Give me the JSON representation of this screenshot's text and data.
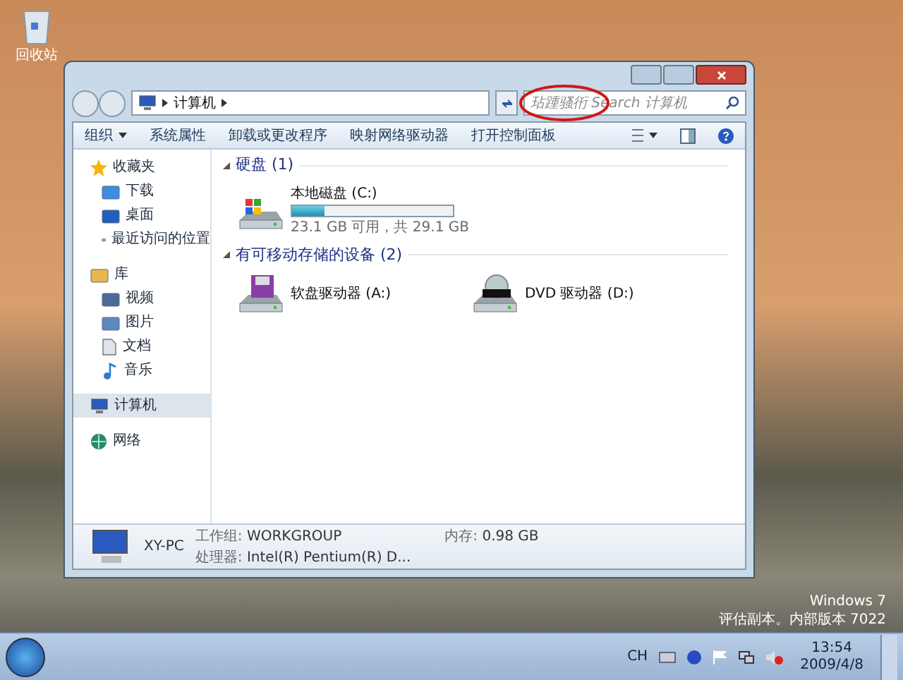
{
  "desktop": {
    "icons": [
      {
        "label": "回收站"
      }
    ],
    "watermark_lines": [
      "Windows 7",
      "评估副本。内部版本 7022"
    ]
  },
  "window": {
    "address": {
      "crumbs": [
        "计算机"
      ]
    },
    "search": {
      "placeholder": "玷踵骚衎 Search 计算机"
    },
    "toolbar": {
      "items": [
        {
          "label": "组织",
          "kind": "menu"
        },
        {
          "label": "系统属性",
          "kind": "button"
        },
        {
          "label": "卸载或更改程序",
          "kind": "button"
        },
        {
          "label": "映射网络驱动器",
          "kind": "button"
        },
        {
          "label": "打开控制面板",
          "kind": "button"
        }
      ]
    },
    "sidebar": {
      "items": [
        {
          "label": "收藏夹",
          "kind": "star",
          "selected": false,
          "children": [
            {
              "label": "下载",
              "kind": "download",
              "selected": false
            },
            {
              "label": "桌面",
              "kind": "desktop",
              "selected": false
            },
            {
              "label": "最近访问的位置",
              "kind": "recent",
              "selected": false
            }
          ]
        },
        {
          "label": "库",
          "kind": "library",
          "selected": false,
          "children": [
            {
              "label": "视频",
              "kind": "video",
              "selected": false
            },
            {
              "label": "图片",
              "kind": "picture",
              "selected": false
            },
            {
              "label": "文档",
              "kind": "document",
              "selected": false
            },
            {
              "label": "音乐",
              "kind": "music",
              "selected": false
            }
          ]
        },
        {
          "label": "计算机",
          "kind": "computer",
          "selected": true
        },
        {
          "label": "网络",
          "kind": "network",
          "selected": false
        }
      ]
    },
    "groups": [
      {
        "title": "硬盘 (1)",
        "drives": [
          {
            "name": "本地磁盘 (C:)",
            "kind": "hdd",
            "level": 0.2,
            "info": "23.1 GB 可用，共 29.1 GB"
          }
        ]
      },
      {
        "title": "有可移动存储的设备 (2)",
        "drives": [
          {
            "name": "软盘驱动器 (A:)",
            "kind": "floppy"
          },
          {
            "name": "DVD 驱动器 (D:)",
            "kind": "dvd"
          }
        ]
      }
    ],
    "details": {
      "name": "XY-PC",
      "fields": [
        {
          "label": "工作组:",
          "value": "WORKGROUP"
        },
        {
          "label": "内存:",
          "value": "0.98 GB"
        },
        {
          "label": "处理器:",
          "value": "Intel(R) Pentium(R) D..."
        }
      ]
    }
  },
  "taskbar": {
    "tray": {
      "language": "CH",
      "date": "2009/4/8",
      "time": "13:54"
    }
  }
}
